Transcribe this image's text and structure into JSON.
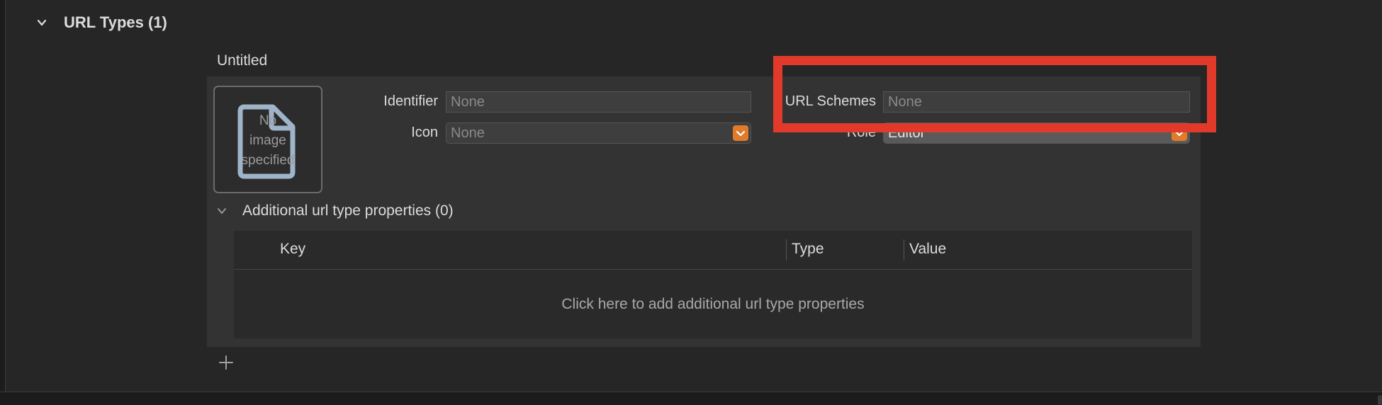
{
  "section": {
    "title": "URL Types (1)",
    "chevron_icon": "chevron-down-icon"
  },
  "entry": {
    "title": "Untitled"
  },
  "image_well": {
    "text": "No\nimage\nspecified",
    "icon": "document-icon"
  },
  "form": {
    "identifier_label": "Identifier",
    "identifier_value": "None",
    "icon_label": "Icon",
    "icon_value": "None",
    "url_schemes_label": "URL Schemes",
    "url_schemes_value": "None",
    "role_label": "Role",
    "role_value": "Editor"
  },
  "additional": {
    "title": "Additional url type properties (0)",
    "columns": [
      "Key",
      "Type",
      "Value"
    ],
    "empty_text": "Click here to add additional url type properties"
  },
  "toolbar": {
    "add_icon": "plus-icon"
  },
  "colors": {
    "accent": "#e07b2c",
    "highlight": "#e23a2a"
  }
}
